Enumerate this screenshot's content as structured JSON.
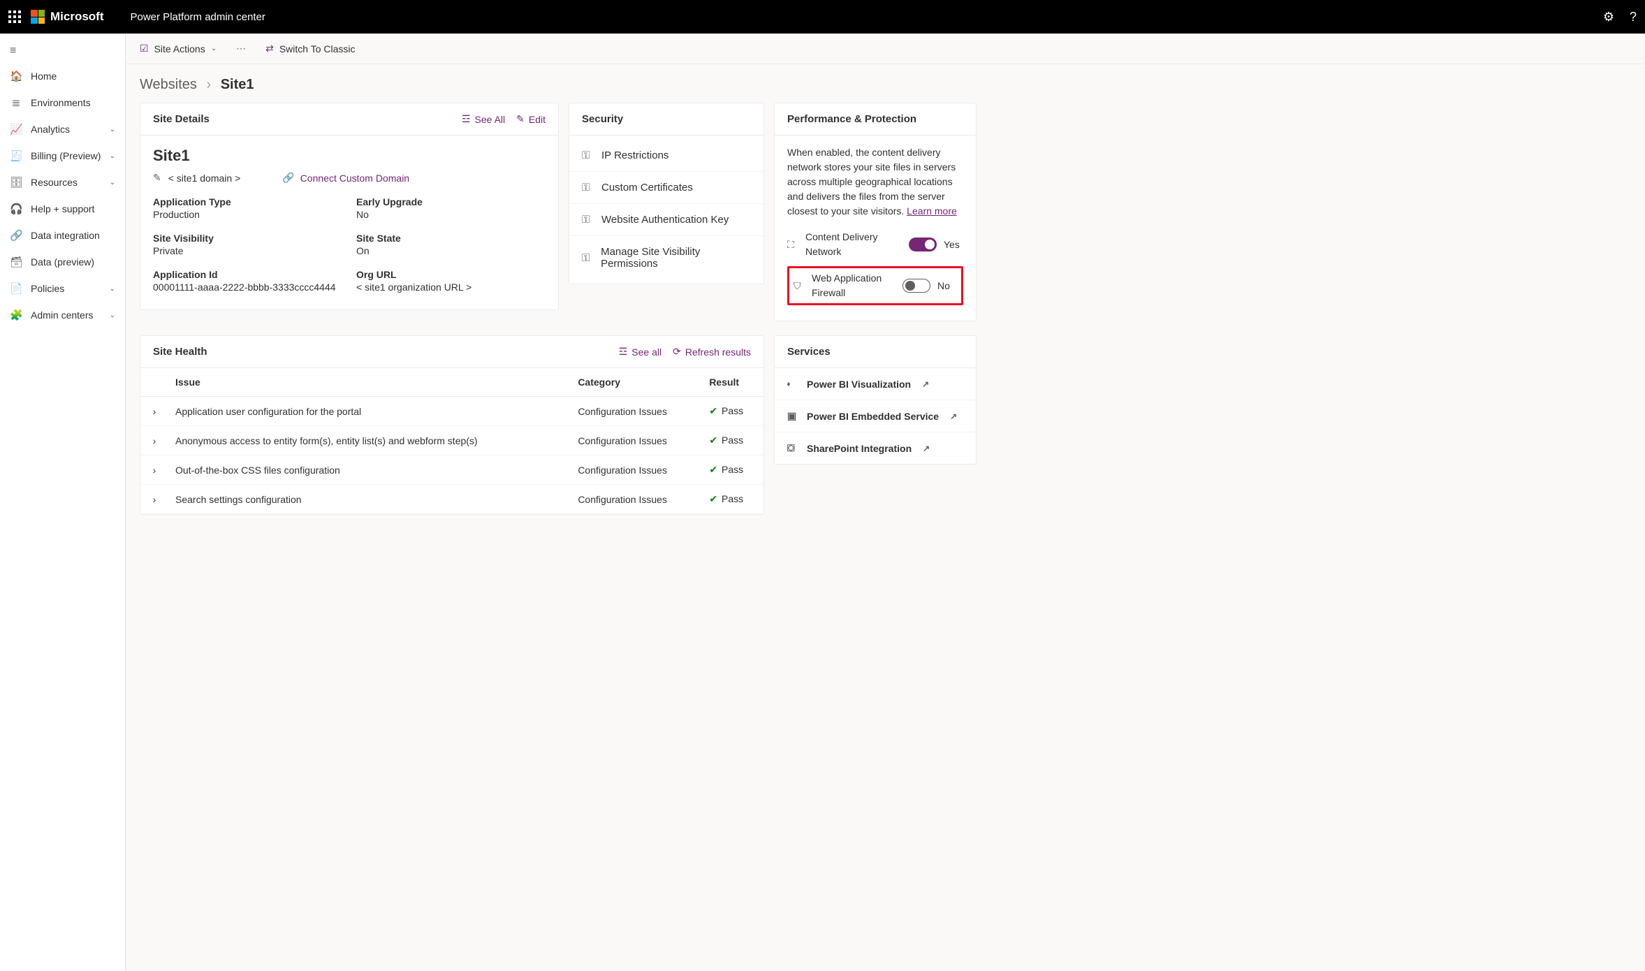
{
  "brand": {
    "company": "Microsoft",
    "app": "Power Platform admin center"
  },
  "topbar": {
    "settings_icon": "gear-icon",
    "help_icon": "help-icon"
  },
  "nav": {
    "items": [
      {
        "icon": "🏠",
        "label": "Home",
        "expandable": false
      },
      {
        "icon": "≣",
        "label": "Environments",
        "expandable": false
      },
      {
        "icon": "📈",
        "label": "Analytics",
        "expandable": true
      },
      {
        "icon": "🧾",
        "label": "Billing (Preview)",
        "expandable": true
      },
      {
        "icon": "🗄",
        "label": "Resources",
        "expandable": true
      },
      {
        "icon": "🎧",
        "label": "Help + support",
        "expandable": false
      },
      {
        "icon": "🔗",
        "label": "Data integration",
        "expandable": false
      },
      {
        "icon": "🗃",
        "label": "Data (preview)",
        "expandable": false
      },
      {
        "icon": "📄",
        "label": "Policies",
        "expandable": true
      },
      {
        "icon": "🧩",
        "label": "Admin centers",
        "expandable": true
      }
    ]
  },
  "commandbar": {
    "site_actions": "Site Actions",
    "switch_classic": "Switch To Classic"
  },
  "breadcrumb": {
    "root": "Websites",
    "current": "Site1"
  },
  "site_details": {
    "card_title": "Site Details",
    "see_all": "See All",
    "edit": "Edit",
    "site_name": "Site1",
    "domain_placeholder": "< site1 domain >",
    "connect_custom_domain": "Connect Custom Domain",
    "fields": {
      "application_type_label": "Application Type",
      "application_type_value": "Production",
      "early_upgrade_label": "Early Upgrade",
      "early_upgrade_value": "No",
      "site_visibility_label": "Site Visibility",
      "site_visibility_value": "Private",
      "site_state_label": "Site State",
      "site_state_value": "On",
      "application_id_label": "Application Id",
      "application_id_value": "00001111-aaaa-2222-bbbb-3333cccc4444",
      "org_url_label": "Org URL",
      "org_url_value": "< site1 organization URL >"
    }
  },
  "security": {
    "card_title": "Security",
    "items": [
      "IP Restrictions",
      "Custom Certificates",
      "Website Authentication Key",
      "Manage Site Visibility Permissions"
    ]
  },
  "performance": {
    "card_title": "Performance & Protection",
    "description": "When enabled, the content delivery network stores your site files in servers across multiple geographical locations and delivers the files from the server closest to your site visitors. ",
    "learn_more": "Learn more",
    "cdn_label": "Content Delivery Network",
    "cdn_state": "Yes",
    "waf_label": "Web Application Firewall",
    "waf_state": "No"
  },
  "site_health": {
    "card_title": "Site Health",
    "see_all": "See all",
    "refresh": "Refresh results",
    "columns": {
      "issue": "Issue",
      "category": "Category",
      "result": "Result"
    },
    "rows": [
      {
        "issue": "Application user configuration for the portal",
        "category": "Configuration Issues",
        "result": "Pass"
      },
      {
        "issue": "Anonymous access to entity form(s), entity list(s) and webform step(s)",
        "category": "Configuration Issues",
        "result": "Pass"
      },
      {
        "issue": "Out-of-the-box CSS files configuration",
        "category": "Configuration Issues",
        "result": "Pass"
      },
      {
        "issue": "Search settings configuration",
        "category": "Configuration Issues",
        "result": "Pass"
      }
    ]
  },
  "services": {
    "card_title": "Services",
    "items": [
      "Power BI Visualization",
      "Power BI Embedded Service",
      "SharePoint Integration"
    ]
  },
  "colors": {
    "accent": "#742774",
    "highlight": "#e81123",
    "pass": "#107c10"
  }
}
